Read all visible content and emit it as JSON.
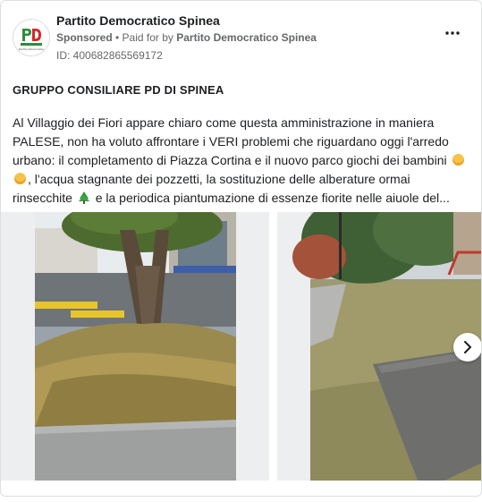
{
  "ad": {
    "page_name": "Partito Democratico Spinea",
    "sponsored_label": "Sponsored",
    "separator": " • ",
    "paid_prefix": "Paid for by ",
    "paid_by": "Partito Democratico Spinea",
    "id_text": "ID: 400682865569172",
    "avatar_icon": "pd-logo-icon",
    "avatar_caption": "Partito Democratico",
    "more_icon": "more-options-icon"
  },
  "post": {
    "title": "GRUPPO CONSILIARE PD DI SPINEA",
    "segments": [
      "Al Villaggio dei Fiori appare chiaro come questa amministrazione in maniera PALESE, non ha voluto affrontare i VERI problemi che riguardano oggi l'arredo urbano: il completamento di Piazza Cortina e il nuovo parco giochi dei bambini",
      ", l'acqua stagnante dei pozzetti, la sostituzione delle alberature ormai rinsecchite",
      "e la periodica piantumazione di essenze fiorite nelle aiuole del..."
    ],
    "emojis": [
      "baby-emoji",
      "baby-emoji",
      "tree-emoji"
    ]
  },
  "carousel": {
    "slides": [
      {
        "name": "photo-tree-street"
      },
      {
        "name": "photo-park-lawn"
      }
    ],
    "next_icon": "chevron-right-icon"
  },
  "colors": {
    "text": "#1c1e21",
    "secondary": "#65676b",
    "pd_green": "#2e8b3a",
    "pd_red": "#d7262b"
  }
}
